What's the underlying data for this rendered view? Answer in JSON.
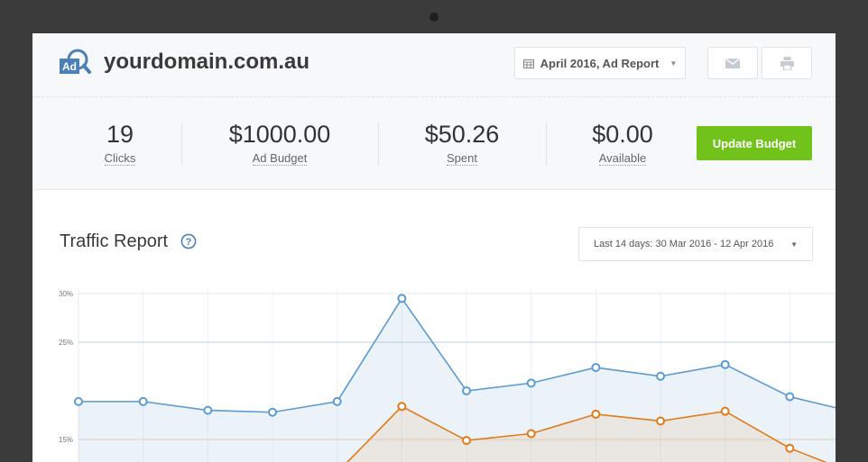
{
  "header": {
    "logo_text": "Ad",
    "domain": "yourdomain.com.au",
    "report_select": "April 2016, Ad Report",
    "email_icon": "envelope-icon",
    "print_icon": "printer-icon"
  },
  "stats": [
    {
      "value": "19",
      "label": "Clicks"
    },
    {
      "value": "$1000.00",
      "label": "Ad Budget"
    },
    {
      "value": "$50.26",
      "label": "Spent"
    },
    {
      "value": "$0.00",
      "label": "Available"
    }
  ],
  "update_button": "Update Budget",
  "traffic": {
    "title": "Traffic Report",
    "help_icon": "question-circle-icon",
    "range": "Last 14 days: 30 Mar 2016 - 12 Apr 2016"
  },
  "colors": {
    "accent_green": "#72c21c",
    "series_blue": "#5b9bd1",
    "series_orange": "#e07b1b"
  },
  "chart_data": {
    "type": "area",
    "y_ticks": [
      "30%",
      "25%",
      "15%"
    ],
    "ylim": [
      8,
      30
    ],
    "series": [
      {
        "values": [
          18.9,
          18.9,
          18.0,
          17.8,
          18.9,
          29.5,
          20.0,
          20.8,
          22.4,
          21.5,
          22.7,
          19.4,
          17.8
        ]
      },
      {
        "values": [
          null,
          null,
          null,
          null,
          11.6,
          18.4,
          14.9,
          15.6,
          17.6,
          16.9,
          17.9,
          14.1,
          11.5
        ]
      }
    ]
  }
}
